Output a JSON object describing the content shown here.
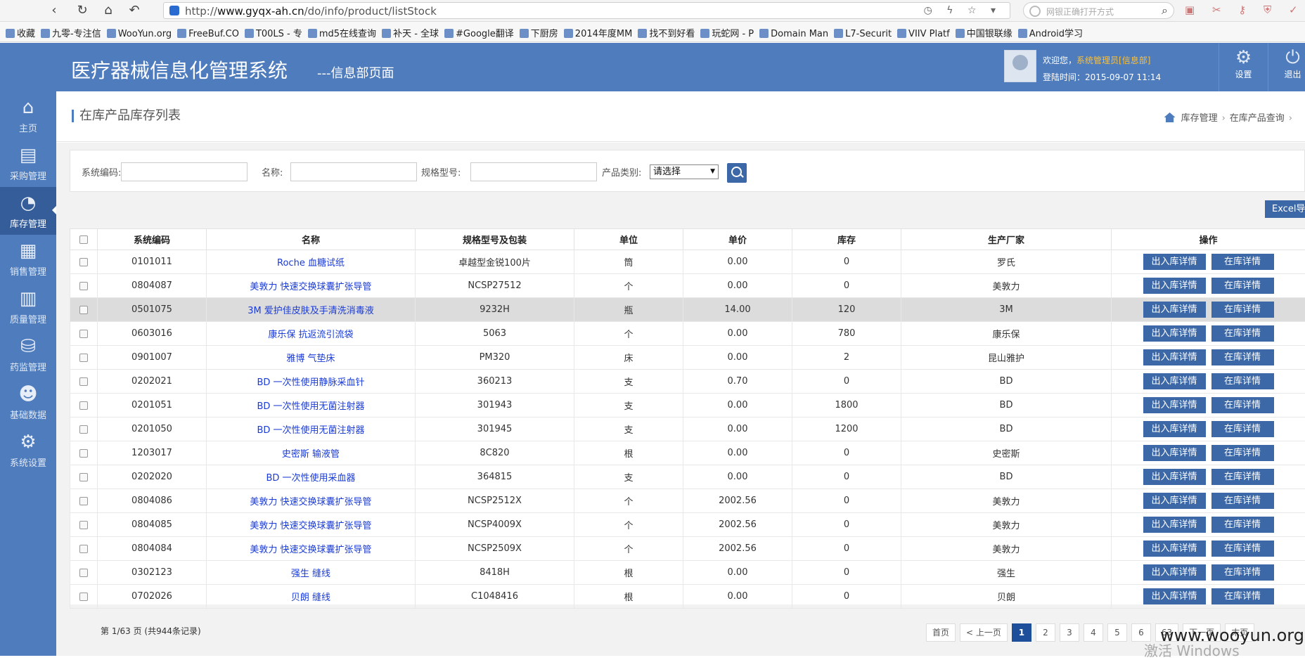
{
  "browser": {
    "url_prefix": "http://",
    "url_host": "www.gyqx-ah.cn",
    "url_path": "/do/info/product/listStock",
    "search_placeholder": "网银正确打开方式",
    "bookmarks": [
      "收藏",
      "九零-专注信",
      "WooYun.org",
      "FreeBuf.CO",
      "T00LS - 专",
      "md5在线查询",
      "补天 - 全球",
      "#Google翻译",
      "下厨房",
      "2014年度MM",
      "找不到好看",
      "玩蛇网 - P",
      "Domain Man",
      "L7-Securit",
      "VIIV Platf",
      "中国银联缘",
      "Android学习"
    ]
  },
  "header": {
    "title": "医疗器械信息化管理系统",
    "subtitle": "---信息部页面",
    "welcome_prefix": "欢迎您，",
    "welcome_role": "系统管理员[信息部]",
    "login_time": "登陆时间：2015-09-07 11:14",
    "settings": "设置",
    "logout": "退出"
  },
  "sidebar": [
    {
      "label": "主页",
      "icon": "home-icon",
      "glyph": "⌂"
    },
    {
      "label": "采购管理",
      "icon": "purchase-icon",
      "glyph": "▤"
    },
    {
      "label": "库存管理",
      "icon": "pie-chart-icon",
      "glyph": "◔"
    },
    {
      "label": "销售管理",
      "icon": "clipboard-icon",
      "glyph": "▦"
    },
    {
      "label": "质量管理",
      "icon": "bar-chart-icon",
      "glyph": "▥"
    },
    {
      "label": "药监管理",
      "icon": "database-icon",
      "glyph": "⛁"
    },
    {
      "label": "基础数据",
      "icon": "user-icon",
      "glyph": "☻"
    },
    {
      "label": "系统设置",
      "icon": "gear-icon",
      "glyph": "⚙"
    }
  ],
  "page": {
    "title": "在库产品库存列表",
    "crumbs": [
      "库存管理",
      "在库产品查询"
    ]
  },
  "filter": {
    "code_label": "系统编码:",
    "name_label": "名称:",
    "spec_label": "规格型号:",
    "category_label": "产品类别:",
    "category_value": "请选择"
  },
  "excel_label": "Excel导出",
  "table": {
    "headers": [
      "系统编码",
      "名称",
      "规格型号及包装",
      "单位",
      "单价",
      "库存",
      "生产厂家",
      "操作"
    ],
    "op1": "出入库详情",
    "op2": "在库详情",
    "rows": [
      [
        "0101011",
        "Roche 血糖试纸",
        "卓越型金锐100片",
        "筒",
        "0.00",
        "0",
        "罗氏"
      ],
      [
        "0804087",
        "美敦力 快速交换球囊扩张导管",
        "NCSP27512",
        "个",
        "0.00",
        "0",
        "美敦力"
      ],
      [
        "0501075",
        "3M 爱护佳皮肤及手清洗消毒液",
        "9232H",
        "瓶",
        "14.00",
        "120",
        "3M"
      ],
      [
        "0603016",
        "康乐保 抗返流引流袋",
        "5063",
        "个",
        "0.00",
        "780",
        "康乐保"
      ],
      [
        "0901007",
        "雅博 气垫床",
        "PM320",
        "床",
        "0.00",
        "2",
        "昆山雅护"
      ],
      [
        "0202021",
        "BD 一次性使用静脉采血针",
        "360213",
        "支",
        "0.70",
        "0",
        "BD"
      ],
      [
        "0201051",
        "BD 一次性使用无菌注射器",
        "301943",
        "支",
        "0.00",
        "1800",
        "BD"
      ],
      [
        "0201050",
        "BD 一次性使用无菌注射器",
        "301945",
        "支",
        "0.00",
        "1200",
        "BD"
      ],
      [
        "1203017",
        "史密斯 输液管",
        "8C820",
        "根",
        "0.00",
        "0",
        "史密斯"
      ],
      [
        "0202020",
        "BD 一次性使用采血器",
        "364815",
        "支",
        "0.00",
        "0",
        "BD"
      ],
      [
        "0804086",
        "美敦力 快速交换球囊扩张导管",
        "NCSP2512X",
        "个",
        "2002.56",
        "0",
        "美敦力"
      ],
      [
        "0804085",
        "美敦力 快速交换球囊扩张导管",
        "NCSP4009X",
        "个",
        "2002.56",
        "0",
        "美敦力"
      ],
      [
        "0804084",
        "美敦力 快速交换球囊扩张导管",
        "NCSP2509X",
        "个",
        "2002.56",
        "0",
        "美敦力"
      ],
      [
        "0302123",
        "强生 缝线",
        "8418H",
        "根",
        "0.00",
        "0",
        "强生"
      ],
      [
        "0702026",
        "贝朗 缝线",
        "C1048416",
        "根",
        "0.00",
        "0",
        "贝朗"
      ]
    ]
  },
  "pager": {
    "info": "第 1/63 页 (共944条记录)",
    "first": "首页",
    "prev": "< 上一页",
    "pages": [
      "1",
      "2",
      "3",
      "4",
      "5",
      "6",
      "63"
    ],
    "next": "下一页",
    "last": "末页"
  },
  "watermark": "www.wooyun.org",
  "os_watermark": "激活 Windows"
}
